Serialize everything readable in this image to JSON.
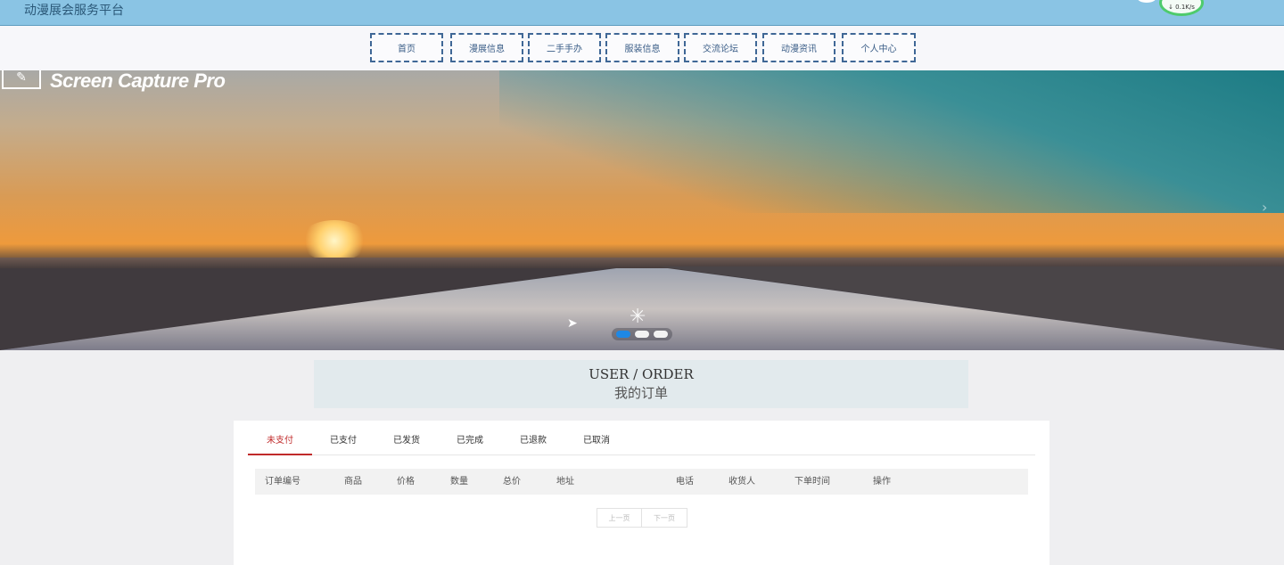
{
  "header": {
    "site_title": "动漫展会服务平台",
    "speed_readout": "↓ 0.1K/s"
  },
  "nav": {
    "items": [
      {
        "label": "首页"
      },
      {
        "label": "漫展信息"
      },
      {
        "label": "二手手办"
      },
      {
        "label": "服装信息"
      },
      {
        "label": "交流论坛"
      },
      {
        "label": "动漫资讯"
      },
      {
        "label": "个人中心"
      }
    ]
  },
  "banner": {
    "watermark": "Screen Capture Pro",
    "watermark_icon": "pen-signature-icon",
    "next_icon": "chevron-right-icon",
    "slide_count": 3,
    "active_slide": 1
  },
  "page_heading": {
    "en": "USER / ORDER",
    "cn": "我的订单"
  },
  "order_tabs": [
    {
      "label": "未支付",
      "active": true
    },
    {
      "label": "已支付",
      "active": false
    },
    {
      "label": "已发货",
      "active": false
    },
    {
      "label": "已完成",
      "active": false
    },
    {
      "label": "已退款",
      "active": false
    },
    {
      "label": "已取消",
      "active": false
    }
  ],
  "table": {
    "columns": [
      "订单编号",
      "商品",
      "价格",
      "数量",
      "总价",
      "地址",
      "电话",
      "收货人",
      "下单时间",
      "操作"
    ],
    "rows": []
  },
  "pagination": {
    "prev": "上一页",
    "next": "下一页"
  },
  "colors": {
    "header_bg": "#8ac4e4",
    "nav_border": "#3f6796",
    "active_tab": "#c02a2a",
    "active_dot": "#1e88e5"
  }
}
